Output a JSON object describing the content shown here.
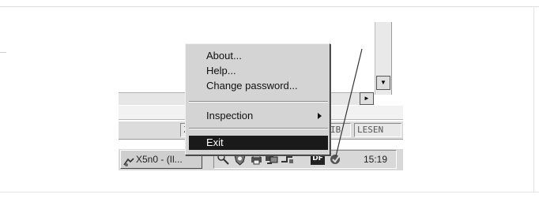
{
  "context_menu": {
    "items": [
      {
        "label": "About..."
      },
      {
        "label": "Help..."
      },
      {
        "label": "Change password..."
      },
      {
        "label": "Inspection"
      },
      {
        "label": "Exit"
      }
    ]
  },
  "taskbar": {
    "task_button_label": "X5n0 - (Il...",
    "clock": "15:19",
    "tray_df_label": "DF"
  },
  "statusbar": {
    "fields": [
      "Z",
      "IB",
      "LESEN"
    ]
  },
  "icons": [
    "scroll-down-arrow-icon",
    "scroll-right-arrow-icon",
    "submenu-arrow-icon",
    "app-icon",
    "network-icon",
    "shield-icon",
    "printer-icon",
    "monitor-icon",
    "connection-icon",
    "security-tray-icon"
  ]
}
